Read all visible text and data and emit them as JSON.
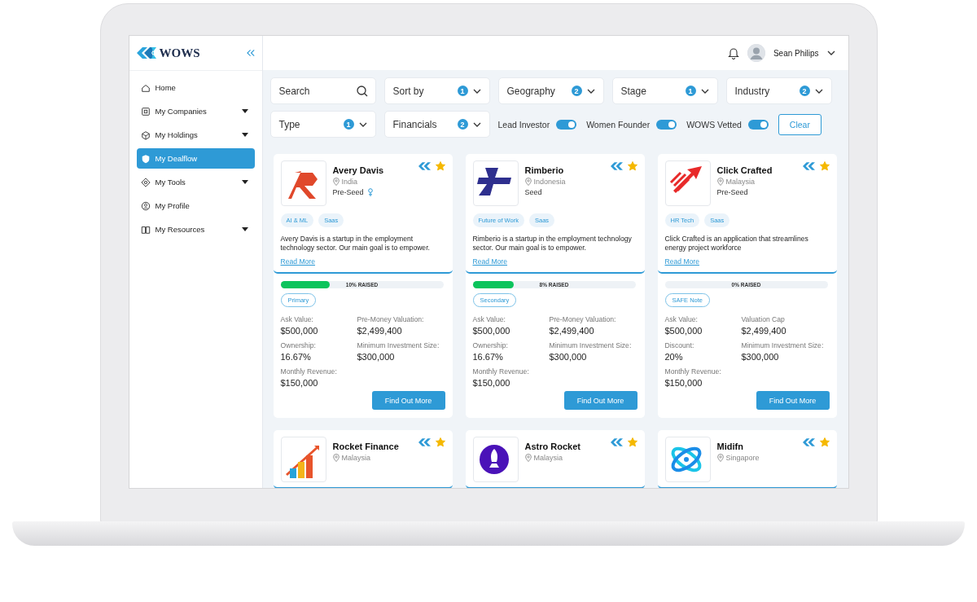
{
  "sidebar": {
    "logo_text": "WOWS",
    "items": [
      {
        "label": "Home",
        "selected": false,
        "expandable": false
      },
      {
        "label": "My Companies",
        "selected": false,
        "expandable": true
      },
      {
        "label": "My Holdings",
        "selected": false,
        "expandable": true
      },
      {
        "label": "My Dealflow",
        "selected": true,
        "expandable": false
      },
      {
        "label": "My Tools",
        "selected": false,
        "expandable": true
      },
      {
        "label": "My Profile",
        "selected": false,
        "expandable": false
      },
      {
        "label": "My Resources",
        "selected": false,
        "expandable": true
      }
    ]
  },
  "top_bar": {
    "user_name": "Sean Philips"
  },
  "filters": {
    "search": {
      "placeholder": "Search"
    },
    "dropdowns": [
      {
        "label": "Sort by",
        "count": "1"
      },
      {
        "label": "Geography",
        "count": "2"
      },
      {
        "label": "Stage",
        "count": "1"
      },
      {
        "label": "Industry",
        "count": "2"
      },
      {
        "label": "Type",
        "count": "1"
      },
      {
        "label": "Financials",
        "count": "2"
      }
    ],
    "toggles": [
      {
        "label": "Lead Investor",
        "on": true
      },
      {
        "label": "Women Founder",
        "on": true
      },
      {
        "label": "WOWS Vetted",
        "on": true
      }
    ],
    "clear_button": "Clear"
  },
  "cards": [
    {
      "name": "Avery Davis",
      "location": "India",
      "stage": "Pre-Seed",
      "women_founder": true,
      "starred": true,
      "tags": [
        "AI & ML",
        "Saas"
      ],
      "description": "Avery Davis is a startup in the employment technology sector. Our main goal is to empower.",
      "read_more": "Read More",
      "level": 0.3,
      "raised": "10% RAISED",
      "deal_type": "Primary",
      "metrics": [
        {
          "label": "Ask Value:",
          "value": "$500,000"
        },
        {
          "label": "Pre-Money Valuation:",
          "value": "$2,499,400"
        },
        {
          "label": "Ownership:",
          "value": "16.67%"
        },
        {
          "label": "Minimum Investment Size:",
          "value": "$300,000"
        },
        {
          "label": "Monthly Revenue:",
          "value": "$150,000"
        }
      ],
      "button": "Find Out More"
    },
    {
      "name": "Rimberio",
      "location": "Indonesia",
      "stage": "Seed",
      "women_founder": false,
      "starred": true,
      "tags": [
        "Future of Work",
        "Saas"
      ],
      "description": "Rimberio is a startup in the employment technology sector. Our main goal is to empower.",
      "read_more": "Read More",
      "level": 0.25,
      "raised": "8% RAISED",
      "deal_type": "Secondary",
      "metrics": [
        {
          "label": "Ask Value:",
          "value": "$500,000"
        },
        {
          "label": "Pre-Money Valuation:",
          "value": "$2,499,400"
        },
        {
          "label": "Ownership:",
          "value": "16.67%"
        },
        {
          "label": "Minimum Investment Size:",
          "value": "$300,000"
        },
        {
          "label": "Monthly Revenue:",
          "value": "$150,000"
        }
      ],
      "button": "Find Out More"
    },
    {
      "name": "Click Crafted",
      "location": "Malaysia",
      "stage": "Pre-Seed",
      "women_founder": false,
      "starred": true,
      "tags": [
        "HR Tech",
        "Saas"
      ],
      "description": "Click Crafted is an application that streamlines energy project workforce",
      "read_more": "Read More",
      "level": 0,
      "raised": "0% RAISED",
      "deal_type": "SAFE Note",
      "metrics": [
        {
          "label": "Ask Value:",
          "value": "$500,000"
        },
        {
          "label": "Valuation Cap",
          "value": "$2,499,400"
        },
        {
          "label": "Discount:",
          "value": "20%"
        },
        {
          "label": "Minimum Investment Size:",
          "value": "$300,000"
        },
        {
          "label": "Monthly Revenue:",
          "value": "$150,000"
        }
      ],
      "button": "Find Out More"
    },
    {
      "name": "Rocket Finance",
      "location": "Malaysia",
      "starred": true
    },
    {
      "name": "Astro Rocket",
      "location": "Malaysia",
      "starred": true
    },
    {
      "name": "Midifn",
      "location": "Singapore",
      "starred": true
    }
  ]
}
